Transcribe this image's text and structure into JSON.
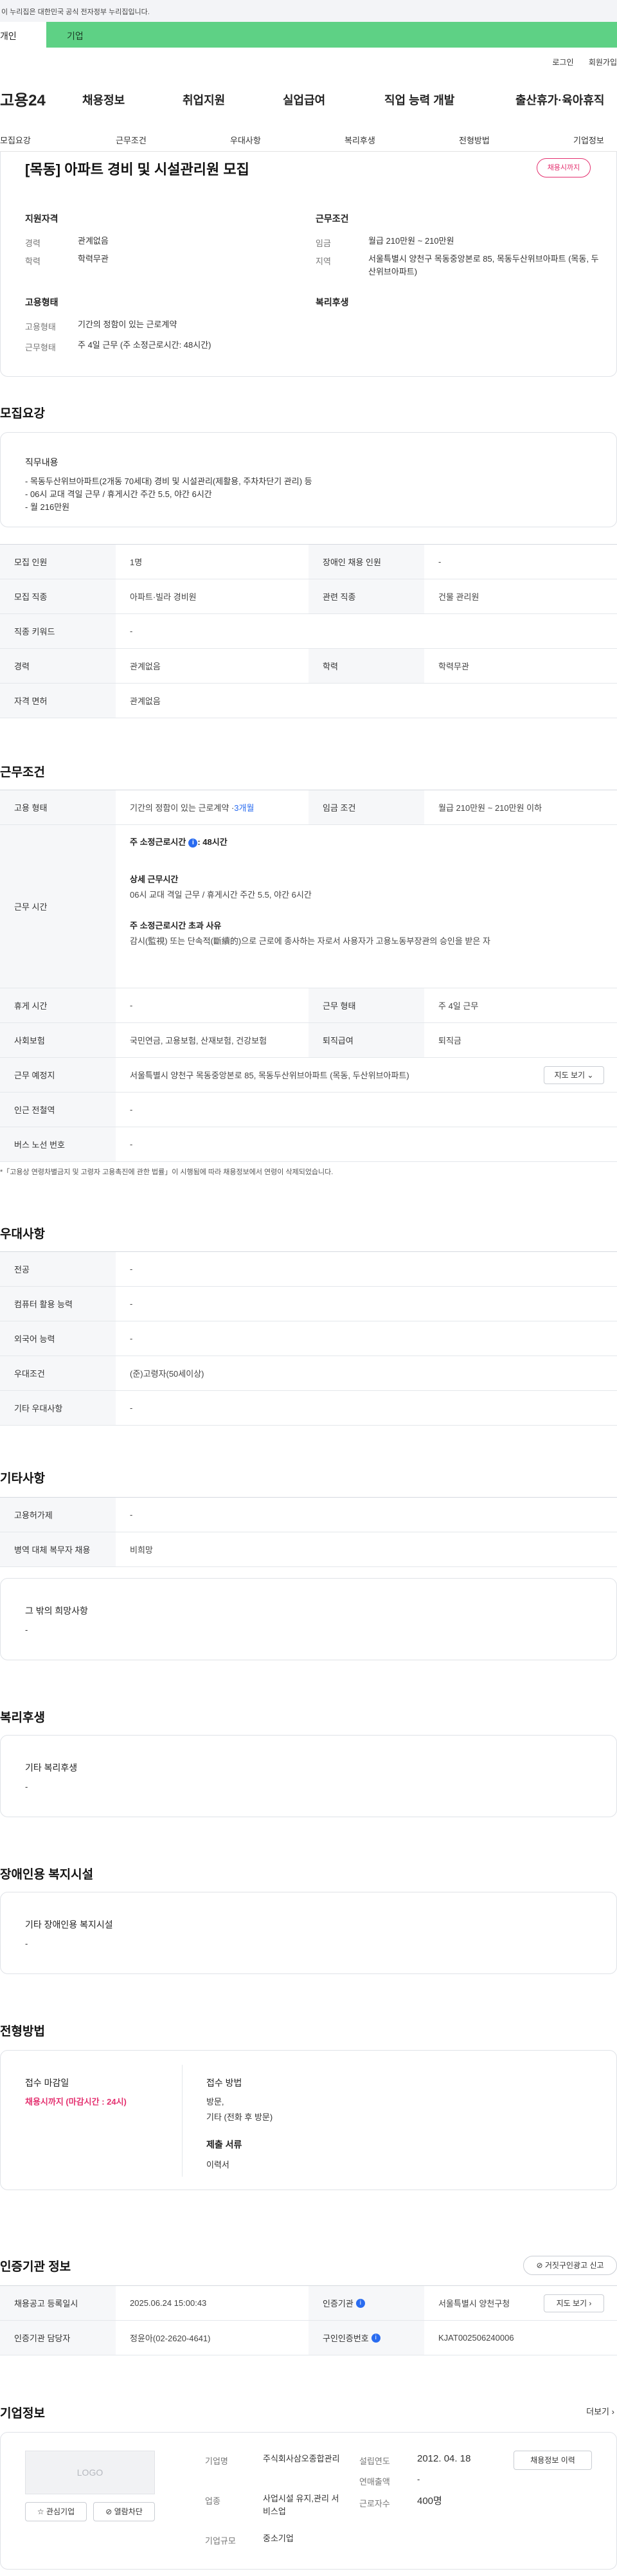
{
  "gov_banner": "이 누리집은 대한민국 공식 전자정부 누리집입니다.",
  "tabs": {
    "personal": "개인",
    "company": "기업"
  },
  "util": {
    "login": "로그인",
    "signup": "회원가입"
  },
  "logo": "고용24",
  "gnb": [
    "채용정보",
    "취업지원",
    "실업급여",
    "직업 능력 개발",
    "출산휴가·육아휴직"
  ],
  "anchor_nav": [
    "모집요강",
    "근무조건",
    "우대사항",
    "복리후생",
    "전형방법",
    "기업정보"
  ],
  "summary": {
    "title": "[목동] 아파트 경비 및 시설관리원 모집",
    "badge": "채용시까지",
    "qual_heading": "지원자격",
    "career_label": "경력",
    "career_value": "관계없음",
    "edu_label": "학력",
    "edu_value": "학력무관",
    "cond_heading": "근무조건",
    "wage_label": "임금",
    "wage_value": "월급 210만원 ~ 210만원",
    "region_label": "지역",
    "region_value": "서울특별시 양천구 목동중앙본로 85, 목동두산위브아파트 (목동, 두산위브아파트)",
    "emp_heading": "고용형태",
    "emp_label": "고용형태",
    "emp_value": "기간의 정함이 있는 근로계약",
    "worktype_label": "근무형태",
    "worktype_value": "주 4일 근무 (주 소정근로시간: 48시간)",
    "welfare_heading": "복리후생"
  },
  "recruit": {
    "section_title": "모집요강",
    "duty_heading": "직무내용",
    "duty_lines": [
      "- 목동두산위브아파트(2개동 70세대) 경비 및 시설관리(제활용, 주차차단기 관리) 등",
      "- 06시 교대 격일 근무 / 휴게시간 주간 5.5, 야간 6시간",
      "- 월 216만원"
    ],
    "rows": [
      {
        "k1": "모집 인원",
        "v1": "1명",
        "k2": "장애인 채용 인원",
        "v2": "-"
      },
      {
        "k1": "모집 직종",
        "v1": "아파트·빌라 경비원",
        "k2": "관련 직종",
        "v2": "건물 관리원"
      },
      {
        "k1": "직종 키워드",
        "v1": "-"
      },
      {
        "k1": "경력",
        "v1": "관계없음",
        "k2": "학력",
        "v2": "학력무관"
      },
      {
        "k1": "자격 면허",
        "v1": "관계없음"
      }
    ]
  },
  "conditions": {
    "section_title": "근무조건",
    "emp_type_label": "고용 형태",
    "emp_type_value": "기간의 정함이 있는 근로계약 · ",
    "emp_type_link": "3개월",
    "wage_label": "임금 조건",
    "wage_value": "월급 210만원 ~ 210만원 이하",
    "hours_label": "근무 시간",
    "weekly_hours_label": "주 소정근로시간",
    "weekly_hours_value": ": 48시간",
    "detail_heading": "상세 근무시간",
    "detail_value": "06시 교대 격일 근무 / 휴게시간 주간 5.5, 야간 6시간",
    "overtime_heading": "주 소정근로시간 초과 사유",
    "overtime_value": "감시(監視) 또는 단속적(斷續的)으로 근로에 종사하는 자로서 사용자가 고용노동부장관의 승인을 받은 자",
    "rest_label": "휴게 시간",
    "rest_value": "-",
    "work_form_label": "근무 형태",
    "work_form_value": "주 4일 근무",
    "insurance_label": "사회보험",
    "insurance_value": "국민연금, 고용보험, 산재보험, 건강보험",
    "retire_label": "퇴직급여",
    "retire_value": "퇴직금",
    "place_label": "근무 예정지",
    "place_value": "서울특별시 양천구 목동중앙본로 85, 목동두산위브아파트 (목동, 두산위브아파트)",
    "map_btn": "지도 보기",
    "station_label": "인근 전철역",
    "station_value": "-",
    "bus_label": "버스 노선 번호",
    "bus_value": "-",
    "note": "*「고용상 연령차별금지 및 고령자 고용촉진에 관한 법률」이 시행됨에 따라 채용정보에서 연령이 삭제되었습니다."
  },
  "preferences": {
    "section_title": "우대사항",
    "rows": [
      {
        "k": "전공",
        "v": "-"
      },
      {
        "k": "컴퓨터 활용 능력",
        "v": "-"
      },
      {
        "k": "외국어 능력",
        "v": "-"
      },
      {
        "k": "우대조건",
        "v": "(준)고령자(50세이상)"
      },
      {
        "k": "기타 우대사항",
        "v": "-"
      }
    ]
  },
  "other": {
    "section_title": "기타사항",
    "rows": [
      {
        "k": "고용허가제",
        "v": "-"
      },
      {
        "k": "병역 대체 복무자 채용",
        "v": "비희망"
      }
    ],
    "wish_heading": "그 밖의 희망사항",
    "wish_value": "-"
  },
  "welfare": {
    "section_title": "복리후생",
    "heading": "기타 복리후생",
    "value": "-"
  },
  "disability": {
    "section_title": "장애인용 복지시설",
    "heading": "기타 장애인용 복지시설",
    "value": "-"
  },
  "selection": {
    "section_title": "전형방법",
    "deadline_label": "접수 마감일",
    "deadline_value": "채용시까지 (마감시간 : 24시)",
    "method_label": "접수 방법",
    "method_value_1": "방문,",
    "method_value_2": "기타 (전화 후 방문)",
    "docs_label": "제출 서류",
    "docs_value": "이력서"
  },
  "agency": {
    "section_title": "인증기관 정보",
    "report_btn": "거짓구인광고 신고",
    "reg_label": "채용공고 등록일시",
    "reg_value": "2025.06.24 15:00:43",
    "agency_label": "인증기관",
    "agency_value": "서울특별시 양천구청",
    "map_btn": "지도 보기",
    "manager_label": "인증기관 담당자",
    "manager_value": "정윤아(02-2620-4641)",
    "jobno_label": "구인인증번호",
    "jobno_value": "KJAT002506240006"
  },
  "company": {
    "section_title": "기업정보",
    "more": "더보기",
    "logo_placeholder": "LOGO",
    "interest_btn": "관심기업",
    "block_btn": "열람차단",
    "name_label": "기업명",
    "name_value": "주식회사삼오종합관리",
    "industry_label": "업종",
    "industry_value": "사업시설 유지,관리 서비스업",
    "size_label": "기업규모",
    "size_value": "중소기업",
    "founded_label": "설립연도",
    "founded_value": "2012. 04. 18",
    "revenue_label": "연매출액",
    "revenue_value": "-",
    "employees_label": "근로자수",
    "employees_value": "400명",
    "jobs_btn": "채용정보 이력"
  }
}
